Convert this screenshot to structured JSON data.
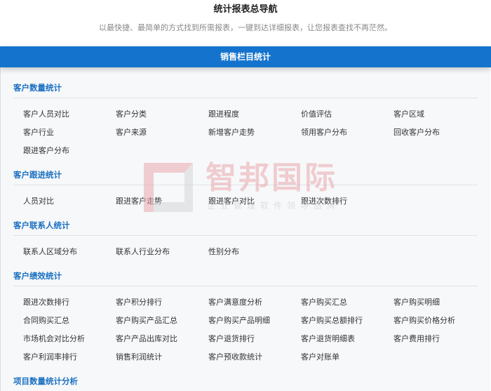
{
  "header": {
    "title": "统计报表总导航",
    "subtitle": "以最快捷、最简单的方式找到所需报表，一键到达详细报表，让您报表查找不再茫然。"
  },
  "bar": {
    "label": "销售栏目统计"
  },
  "colors": {
    "accent": "#1473cc",
    "section_heading": "#1a6fc0",
    "panel_bg": "#f7f8fa"
  },
  "watermark": {
    "brand": "智邦国际",
    "slogan": "企业管理软件领导品牌"
  },
  "sections": [
    {
      "title": "客户数量统计",
      "items": [
        "客户人员对比",
        "客户分类",
        "跟进程度",
        "价值评估",
        "客户区域",
        "客户行业",
        "客户来源",
        "新增客户走势",
        "领用客户分布",
        "回收客户分布",
        "跟进客户分布"
      ]
    },
    {
      "title": "客户跟进统计",
      "items": [
        "人员对比",
        "跟进客户走势",
        "跟进客户对比",
        "跟进次数排行"
      ]
    },
    {
      "title": "客户联系人统计",
      "items": [
        "联系人区域分布",
        "联系人行业分布",
        "性别分布"
      ]
    },
    {
      "title": "客户绩效统计",
      "items": [
        "跟进次数排行",
        "客户积分排行",
        "客户满意度分析",
        "客户购买汇总",
        "客户购买明细",
        "合同购买汇总",
        "客户购买产品汇总",
        "客户购买产品明细",
        "客户购买总额排行",
        "客户购买价格分析",
        "市场机会对比分析",
        "客户产品出库对比",
        "客户退货排行",
        "客户退货明细表",
        "客户费用排行",
        "客户利润率排行",
        "销售利润统计",
        "客户预收款统计",
        "客户对账单"
      ]
    },
    {
      "title": "项目数量统计分析",
      "items": []
    }
  ]
}
